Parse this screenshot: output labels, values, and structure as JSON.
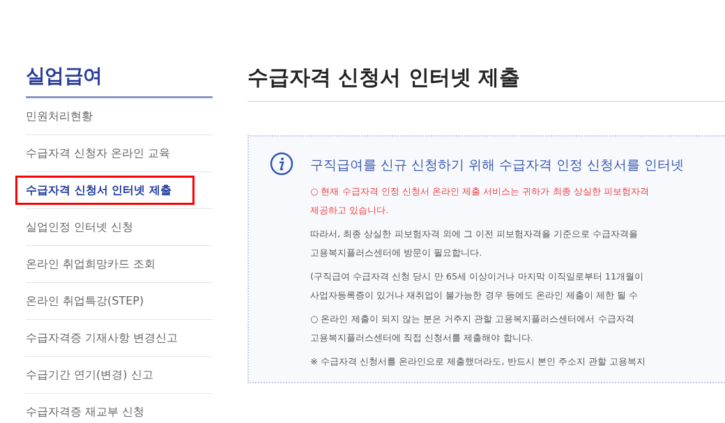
{
  "sidebar": {
    "title": "실업급여",
    "items": [
      {
        "label": "민원처리현황",
        "selected": false
      },
      {
        "label": "수급자격 신청자 온라인 교육",
        "selected": false
      },
      {
        "label": "수급자격 신청서 인터넷 제출",
        "selected": true
      },
      {
        "label": "실업인정 인터넷 신청",
        "selected": false
      },
      {
        "label": "온라인 취업희망카드 조회",
        "selected": false
      },
      {
        "label": "온라인 취업특강(STEP)",
        "selected": false
      },
      {
        "label": "수급자격증 기재사항 변경신고",
        "selected": false
      },
      {
        "label": "수급기간 연기(변경) 신고",
        "selected": false
      },
      {
        "label": "수급자격증 재교부 신청",
        "selected": false
      }
    ]
  },
  "page_title": "수급자격 신청서 인터넷 제출",
  "notice": {
    "heading": "구직급여를 신규 신청하기 위해 수급자격 인정 신청서를 인터넷",
    "paragraphs": [
      {
        "kind": "warning",
        "lines": [
          "○ 현재 수급자격 인정 신청서 온라인 제출 서비스는 귀하가 최종 상실한 피보험자격",
          "제공하고 있습니다."
        ]
      },
      {
        "kind": "normal",
        "lines": [
          "따라서, 최종 상실한 피보험자격 외에 그 이전 피보험자격을 기준으로 수급자격을",
          "고용복지플러스센터에 방문이 필요합니다."
        ]
      },
      {
        "kind": "normal",
        "lines": [
          "(구직급여 수급자격 신청 당시 만 65세 이상이거나 마지막 이직일로부터 11개월이",
          "사업자등록증이 있거나 재취업이 불가능한 경우 등에도 온라인 제출이 제한 될 수"
        ]
      },
      {
        "kind": "normal",
        "lines": [
          "○ 온라인 제출이 되지 않는 분은 거주지 관할 고용복지플러스센터에서 수급자격",
          "고용복지플러스센터에 직접 신청서를 제출해야 합니다."
        ]
      },
      {
        "kind": "normal",
        "lines": [
          "※ 수급자격 신청서를 온라인으로 제출했더라도, 반드시 본인 주소지 관할 고용복지"
        ]
      }
    ]
  }
}
